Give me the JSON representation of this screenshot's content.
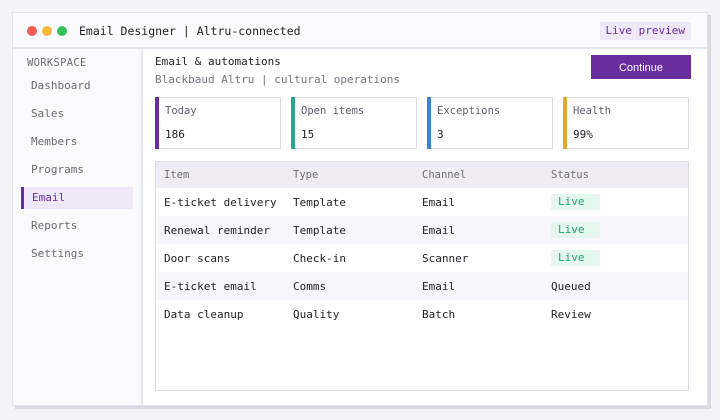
{
  "window": {
    "title": "Email Designer  |  Altru-connected",
    "live_preview": "Live preview"
  },
  "sidebar": {
    "heading": "WORKSPACE",
    "items": [
      {
        "label": "Dashboard"
      },
      {
        "label": "Sales"
      },
      {
        "label": "Members"
      },
      {
        "label": "Programs"
      },
      {
        "label": "Email"
      },
      {
        "label": "Reports"
      },
      {
        "label": "Settings"
      }
    ],
    "active": "Email"
  },
  "header": {
    "title": "Email & automations",
    "subtitle": "Blackbaud Altru  |  cultural operations",
    "continue_label": "Continue"
  },
  "cards": [
    {
      "label": "Today",
      "value": "186",
      "accent": "#6a2d9e"
    },
    {
      "label": "Open items",
      "value": "15",
      "accent": "#2aa58c"
    },
    {
      "label": "Exceptions",
      "value": "3",
      "accent": "#3a86d1"
    },
    {
      "label": "Health",
      "value": "99%",
      "accent": "#e0a82e"
    }
  ],
  "table": {
    "columns": [
      "Item",
      "Type",
      "Channel",
      "Status"
    ],
    "rows": [
      {
        "item": "E-ticket delivery",
        "type": "Template",
        "channel": "Email",
        "status": "Live"
      },
      {
        "item": "Renewal reminder",
        "type": "Template",
        "channel": "Email",
        "status": "Live"
      },
      {
        "item": "Door scans",
        "type": "Check-in",
        "channel": "Scanner",
        "status": "Live"
      },
      {
        "item": "E-ticket email",
        "type": "Comms",
        "channel": "Email",
        "status": "Queued"
      },
      {
        "item": "Data cleanup",
        "type": "Quality",
        "channel": "Batch",
        "status": "Review"
      }
    ]
  },
  "colors": {
    "brand": "#6a2d9e",
    "live_badge_bg": "#e4f6ee",
    "live_badge_text": "#22a06b"
  }
}
